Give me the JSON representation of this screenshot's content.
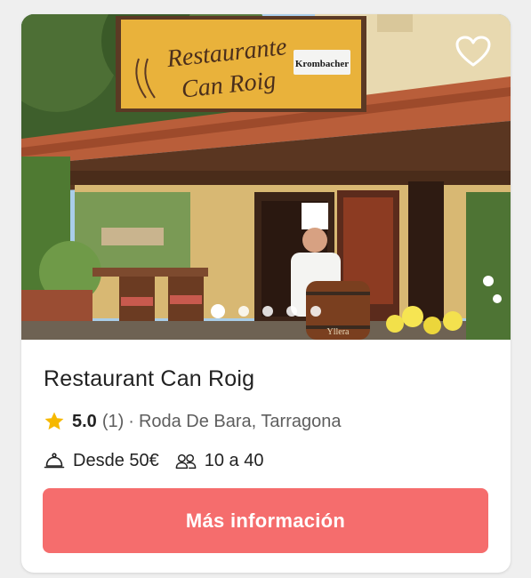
{
  "listing": {
    "name": "Restaurant Can Roig",
    "rating": "5.0",
    "reviews": "(1)",
    "separator": "·",
    "location": "Roda De Bara, Tarragona",
    "price": "Desde 50€",
    "guests": "10 a 40",
    "cta_label": "Más información"
  },
  "photo": {
    "sign_line1": "Restaurante",
    "sign_line2": "Can Roig",
    "sign_brand": "Krombacher",
    "barrel_text": "Yllera",
    "carousel_dots": 5,
    "active_dot": 1
  },
  "colors": {
    "accent": "#f56d6d",
    "star": "#f6b800",
    "text": "#222222",
    "muted": "#5e5e5e"
  },
  "icons": {
    "favorite": "heart-icon",
    "rating": "star-icon",
    "price": "cloche-icon",
    "guests": "people-icon"
  }
}
